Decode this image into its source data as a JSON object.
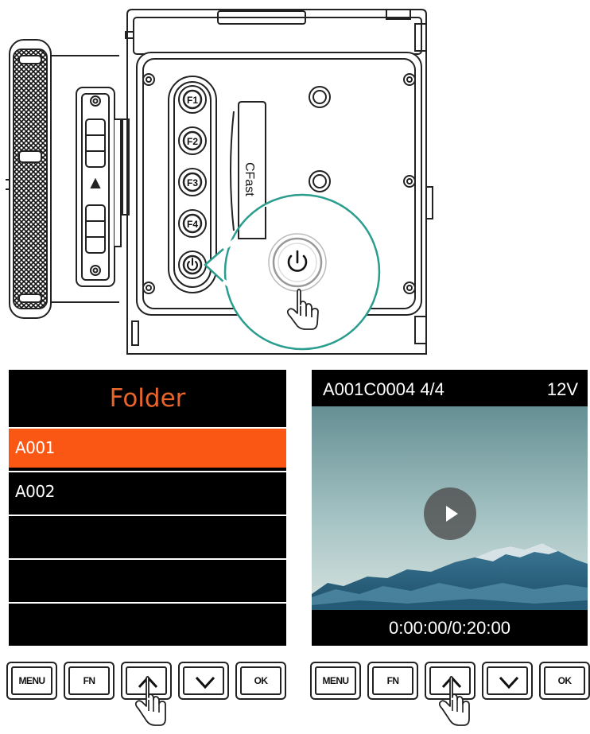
{
  "camera": {
    "function_buttons": [
      "F1",
      "F2",
      "F3",
      "F4"
    ],
    "card_slot_label": "CFast",
    "power_icon": "power-icon",
    "pointer_icon": "hand-pointer-icon",
    "accent_color": "#2a9d8f"
  },
  "folder_screen": {
    "title": "Folder",
    "title_color": "#e8642a",
    "selected_color": "#fa5614",
    "items": [
      "A001",
      "A002",
      "",
      "",
      ""
    ],
    "selected_index": 0
  },
  "playback_screen": {
    "clip": "A001C0004 4/4",
    "voltage": "12V",
    "timecode": "0:00:00/0:20:00",
    "play_icon": "play-icon"
  },
  "button_rows": [
    {
      "buttons": [
        "MENU",
        "FN",
        "up-arrow-icon",
        "down-arrow-icon",
        "OK"
      ],
      "pressed": "up-arrow-icon"
    },
    {
      "buttons": [
        "MENU",
        "FN",
        "up-arrow-icon",
        "down-arrow-icon",
        "OK"
      ],
      "pressed": "up-arrow-icon"
    }
  ]
}
